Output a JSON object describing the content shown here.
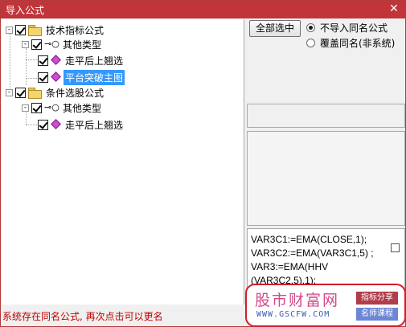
{
  "window": {
    "title": "导入公式",
    "close_glyph": "✕"
  },
  "tree": {
    "items": [
      {
        "label": "技术指标公式",
        "expander": "-",
        "checked": true,
        "icon": "folder-icon"
      },
      {
        "label": "其他类型",
        "expander": "-",
        "checked": true,
        "icon": "key-icon"
      },
      {
        "label": "走平后上翘选",
        "checked": true,
        "icon": "formula-icon"
      },
      {
        "label": "平台突破主图",
        "checked": true,
        "icon": "formula-icon",
        "selected": true
      },
      {
        "label": "条件选股公式",
        "expander": "-",
        "checked": true,
        "icon": "folder-icon"
      },
      {
        "label": "其他类型",
        "expander": "-",
        "checked": true,
        "icon": "key-icon"
      },
      {
        "label": "走平后上翘选",
        "checked": true,
        "icon": "formula-icon"
      }
    ]
  },
  "options": {
    "select_all_label": "全部选中",
    "radio_no_import": "不导入同名公式",
    "radio_overwrite": "覆盖同名(非系统)",
    "selected": "radio_no_import"
  },
  "code_preview": {
    "lines": [
      "VAR3C1:=EMA(CLOSE,1);",
      "VAR3C2:=EMA(VAR3C1,5) ;",
      "VAR3:=EMA(HHV",
      "(VAR3C2,5),1);"
    ]
  },
  "status_message": "系统存在同名公式, 再次点击可以更名",
  "watermark": {
    "site_name": "股市财富网",
    "url": "WWW.GSCFW.COM",
    "tag1": "指标分享",
    "tag2": "名师课程"
  },
  "colors": {
    "titlebar": "#c0343a",
    "selection": "#3399ff",
    "status": "#c00000"
  }
}
